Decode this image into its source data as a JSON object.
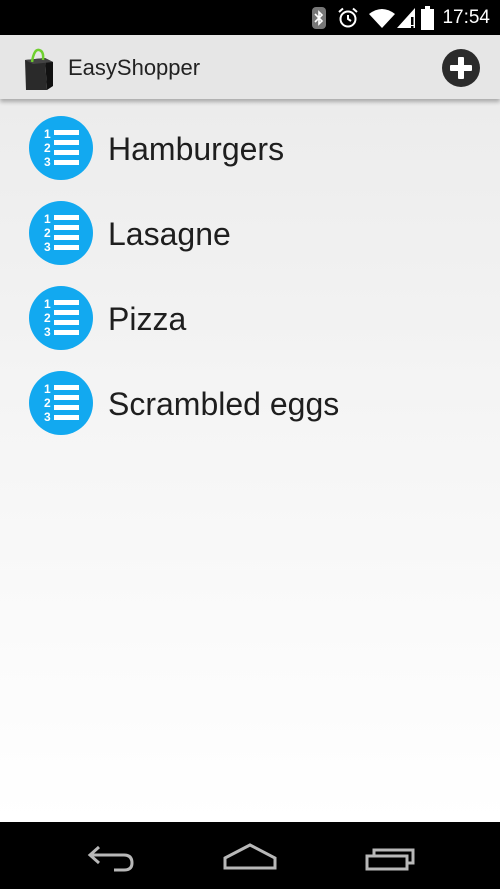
{
  "status_bar": {
    "time": "17:54",
    "icons": [
      "bluetooth-icon",
      "alarm-icon",
      "wifi-icon",
      "signal-icon",
      "battery-icon"
    ]
  },
  "action_bar": {
    "title": "EasyShopper",
    "app_icon": "shopping-bag-icon",
    "add_icon": "add-circle-icon"
  },
  "lists": [
    {
      "label": "Hamburgers",
      "icon": "numbered-list-icon"
    },
    {
      "label": "Lasagne",
      "icon": "numbered-list-icon"
    },
    {
      "label": "Pizza",
      "icon": "numbered-list-icon"
    },
    {
      "label": "Scrambled eggs",
      "icon": "numbered-list-icon"
    }
  ],
  "nav_bar": {
    "buttons": [
      "back-icon",
      "home-icon",
      "recent-apps-icon"
    ]
  },
  "colors": {
    "list_icon": "#12a9f0",
    "action_bar": "#e6e6e6",
    "add_button": "#2b2b2b",
    "app_icon_accent": "#6fcf2f"
  }
}
